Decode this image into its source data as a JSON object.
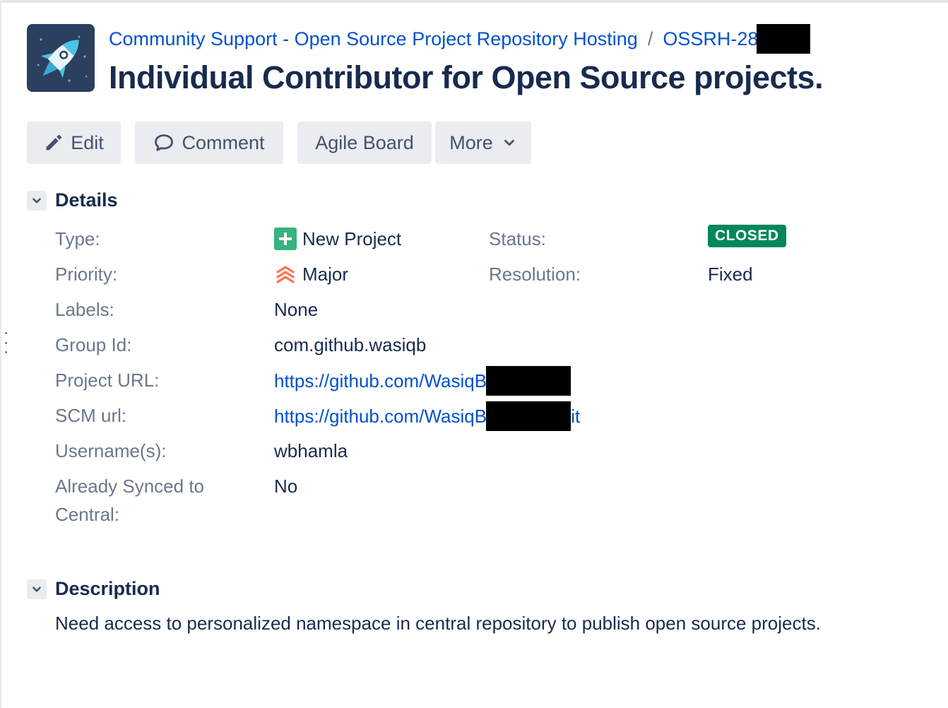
{
  "breadcrumb": {
    "project": "Community Support - Open Source Project Repository Hosting",
    "separator": "/",
    "issue_key": "OSSRH-28"
  },
  "issue": {
    "summary": "Individual Contributor for Open Source projects."
  },
  "toolbar": {
    "edit": "Edit",
    "comment": "Comment",
    "agile_board": "Agile Board",
    "more": "More"
  },
  "details": {
    "title": "Details",
    "type_label": "Type:",
    "type_value": "New Project",
    "status_label": "Status:",
    "status_value": "CLOSED",
    "priority_label": "Priority:",
    "priority_value": "Major",
    "resolution_label": "Resolution:",
    "resolution_value": "Fixed",
    "labels_label": "Labels:",
    "labels_value": "None",
    "group_id_label": "Group Id:",
    "group_id_value": "com.github.wasiqb",
    "project_url_label": "Project URL:",
    "project_url_value": "https://github.com/WasiqB/",
    "scm_url_label": "SCM url:",
    "scm_url_value": "https://github.com/WasiqB/",
    "scm_url_suffix": "it",
    "usernames_label": "Username(s):",
    "usernames_value": "wbhamla",
    "synced_label_line1": "Already Synced to",
    "synced_label_line2": "Central:",
    "synced_value": "No"
  },
  "description": {
    "title": "Description",
    "text": "Need access to personalized namespace in central repository to publish open source projects."
  },
  "colors": {
    "link": "#0052cc",
    "status_closed": "#00875a",
    "type_new_project": "#36b37e",
    "priority_major": "#ff7452",
    "button_bg": "#ebecf0"
  },
  "icons": {
    "project_avatar": "rocket-icon",
    "edit": "pencil-icon",
    "comment": "speech-bubble-icon",
    "more": "chevron-down-icon",
    "section_toggle": "chevron-down-icon",
    "type": "plus-square-icon",
    "priority": "double-chevron-up-icon"
  }
}
